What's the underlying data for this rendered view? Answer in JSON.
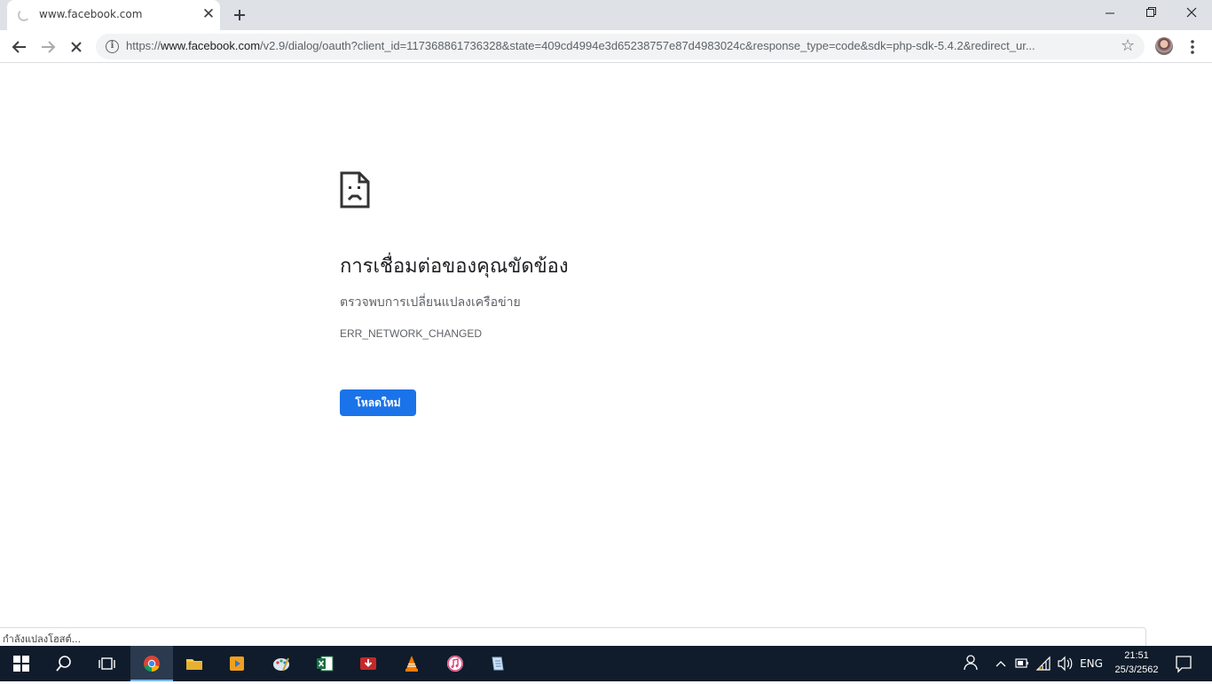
{
  "browser": {
    "tab": {
      "title": "www.facebook.com"
    },
    "address": {
      "scheme": "https://",
      "host": "www.facebook.com",
      "path": "/v2.9/dialog/oauth?client_id=117368861736328&state=409cd4994e3d65238757e87d4983024c&response_type=code&sdk=php-sdk-5.4.2&redirect_ur..."
    },
    "status_text": "กำลังแปลงโฮสต์..."
  },
  "error_page": {
    "heading": "การเชื่อมต่อของคุณขัดข้อง",
    "description": "ตรวจพบการเปลี่ยนแปลงเครือข่าย",
    "error_code": "ERR_NETWORK_CHANGED",
    "reload_label": "โหลดใหม่"
  },
  "taskbar": {
    "apps": [
      "start-icon",
      "search-icon",
      "task-view-icon",
      "chrome-icon",
      "file-explorer-icon",
      "media-player-icon",
      "paint-icon",
      "excel-icon",
      "download-manager-icon",
      "vlc-icon",
      "itunes-icon",
      "notepad-icon"
    ],
    "active_app": "chrome-icon",
    "language": "ENG",
    "time": "21:51",
    "date": "25/3/2562"
  },
  "colors": {
    "accent": "#1a73e8",
    "tabstrip": "#dee1e6",
    "taskbar": "#101c2b"
  }
}
